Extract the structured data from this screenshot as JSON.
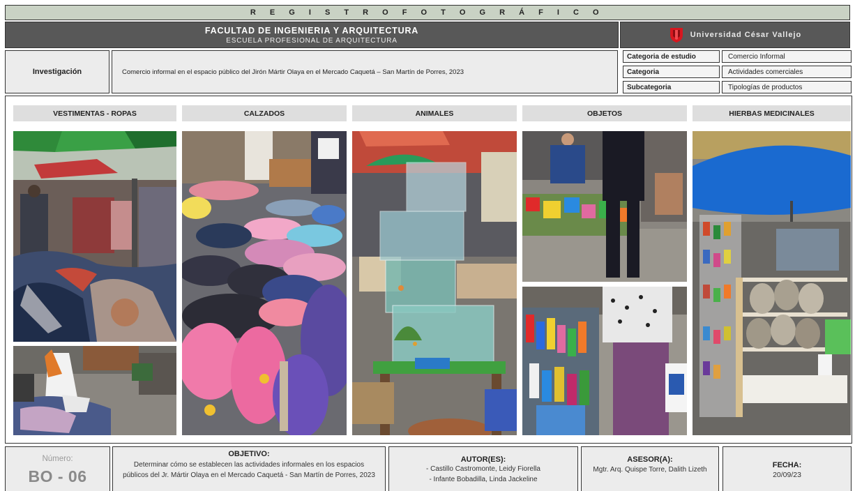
{
  "header": {
    "title": "R E G I S T R O   F O T O G R Á F I C O",
    "faculty": "FACULTAD DE INGENIERIA Y ARQUITECTURA",
    "school": "ESCUELA PROFESIONAL DE ARQUITECTURA",
    "university": "Universidad César Vallejo",
    "university_logo_color": "#d7171f"
  },
  "investigation": {
    "label": "Investigación",
    "text": "Comercio informal en el espacio público del Jirón Mártir Olaya en el Mercado Caquetá – San Martín de Porres, 2023"
  },
  "classification": [
    {
      "label": "Categoria de estudio",
      "value": "Comercio Informal"
    },
    {
      "label": "Categoria",
      "value": "Actividades comerciales"
    },
    {
      "label": "Subcategoria",
      "value": "Tipologías de productos"
    }
  ],
  "categories": [
    {
      "label": "VESTIMENTAS - ROPAS"
    },
    {
      "label": "CALZADOS"
    },
    {
      "label": "ANIMALES"
    },
    {
      "label": "OBJETOS"
    },
    {
      "label": "HIERBAS MEDICINALES"
    }
  ],
  "footer": {
    "numero_label": "Número:",
    "numero_value": "BO - 06",
    "objetivo_title": "OBJETIVO:",
    "objetivo_text": "Determinar cómo se establecen las actividades informales en los espacios públicos del Jr. Mártir Olaya en el Mercado Caquetá - San Martín de Porres, 2023",
    "autor_title": "AUTOR(ES):",
    "autores": [
      "- Castillo Castromonte, Leidy Fiorella",
      "- Infante Bobadilla, Linda Jackeline"
    ],
    "asesor_title": "ASESOR(A):",
    "asesor_text": "Mgtr. Arq. Quispe Torre, Dalith Lizeth",
    "fecha_title": "FECHA:",
    "fecha_value": "20/09/23"
  }
}
